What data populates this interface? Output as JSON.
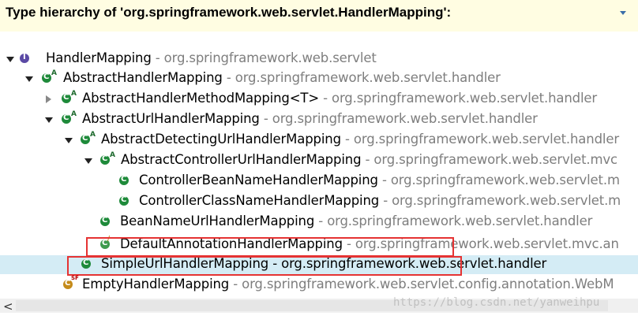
{
  "header": {
    "title": "Type hierarchy of 'org.springframework.web.servlet.HandlerMapping':"
  },
  "tree": [
    {
      "name": "HandlerMapping",
      "pkg": " - org.springframework.web.servlet"
    },
    {
      "name": "AbstractHandlerMapping",
      "pkg": " - org.springframework.web.servlet.handler"
    },
    {
      "name": "AbstractHandlerMethodMapping<T>",
      "pkg": " - org.springframework.web.servlet.handler"
    },
    {
      "name": "AbstractUrlHandlerMapping",
      "pkg": " - org.springframework.web.servlet.handler"
    },
    {
      "name": "AbstractDetectingUrlHandlerMapping",
      "pkg": " - org.springframework.web.servlet.handler"
    },
    {
      "name": "AbstractControllerUrlHandlerMapping",
      "pkg": " - org.springframework.web.servlet.mvc"
    },
    {
      "name": "ControllerBeanNameHandlerMapping",
      "pkg": " - org.springframework.web.servlet.m"
    },
    {
      "name": "ControllerClassNameHandlerMapping",
      "pkg": " - org.springframework.web.servlet.m"
    },
    {
      "name": "BeanNameUrlHandlerMapping",
      "pkg": " - org.springframework.web.servlet.handler"
    },
    {
      "name": "DefaultAnnotationHandlerMapping",
      "pkg": " - org.springframework.web.servlet.mvc.an"
    },
    {
      "name": "SimpleUrlHandlerMapping",
      "pkg": " - org.springframework.web.servlet.handler"
    },
    {
      "name": "EmptyHandlerMapping",
      "pkg": " - org.springframework.web.servlet.config.annotation.WebM"
    }
  ],
  "watermark": "https://blog.csdn.net/yanweihpu"
}
